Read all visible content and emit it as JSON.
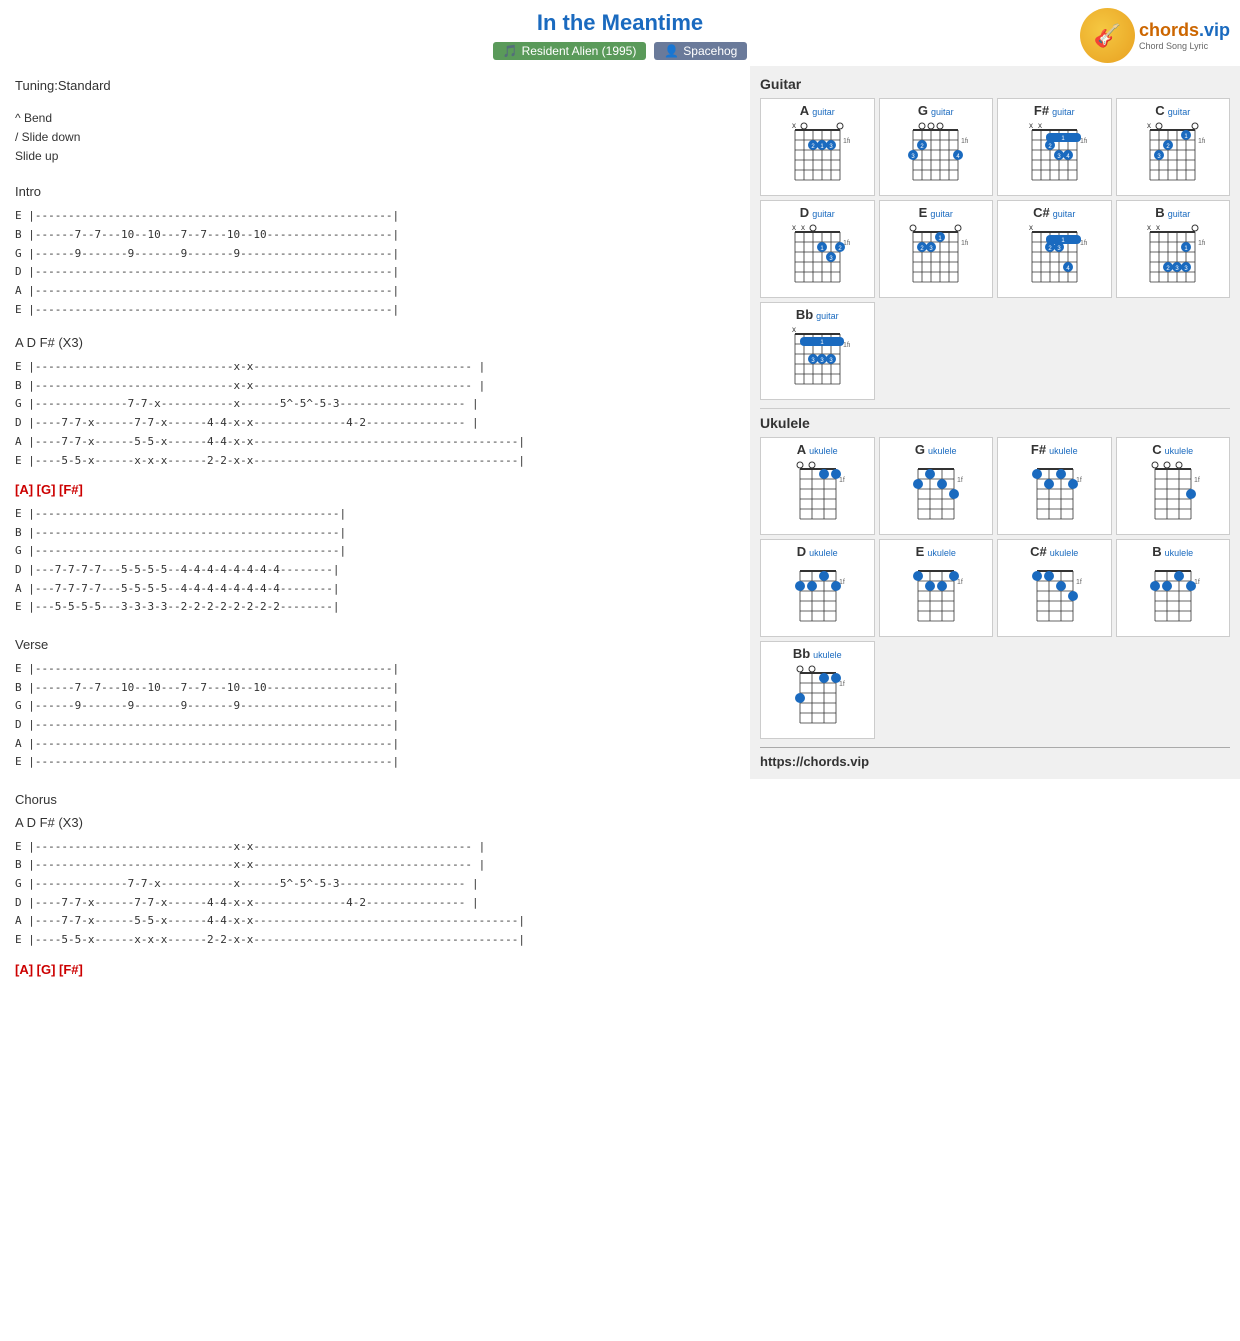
{
  "header": {
    "title": "In the Meantime",
    "album_tag": "Resident Alien (1995)",
    "artist_tag": "Spacehog",
    "logo_url": "chords.vip"
  },
  "left": {
    "tuning": "Tuning:Standard",
    "legend": [
      "^ Bend",
      "/ Slide down",
      "Slide up"
    ],
    "sections": [
      {
        "type": "label",
        "text": "Intro"
      },
      {
        "type": "tab",
        "lines": [
          "E |------------------------------------------------------|",
          "B |------7--7---10--10---7--7---10--10-------------------|",
          "G |------9-------9-------9-------9-----------------------|",
          "D |------------------------------------------------------|",
          "A |------------------------------------------------------|",
          "E |------------------------------------------------------|"
        ]
      },
      {
        "type": "label",
        "text": "A D F# (X3)"
      },
      {
        "type": "tab",
        "lines": [
          "E |------------------------------x-x--------------------------------- |",
          "B |------------------------------x-x--------------------------------- |",
          "G |--------------7-7-x-----------x------5^-5^-5-3------------------- |",
          "D |----7-7-x------7-7-x------4-4-x-x--------------4-2--------------- |",
          "A |----7-7-x------5-5-x------4-4-x-x----------------------------------------|",
          "E |----5-5-x------x-x-x------2-2-x-x----------------------------------------|"
        ]
      },
      {
        "type": "chord_line",
        "text": "[A] [G] [F#]"
      },
      {
        "type": "tab",
        "lines": [
          "E |----------------------------------------------|",
          "B |----------------------------------------------|",
          "G |----------------------------------------------|",
          "D |---7-7-7-7---5-5-5-5--4-4-4-4-4-4-4-4--------|",
          "A |---7-7-7-7---5-5-5-5--4-4-4-4-4-4-4-4--------|",
          "E |---5-5-5-5---3-3-3-3--2-2-2-2-2-2-2-2--------|"
        ]
      },
      {
        "type": "label",
        "text": "Verse"
      },
      {
        "type": "tab",
        "lines": [
          "E |------------------------------------------------------|",
          "B |------7--7---10--10---7--7---10--10-------------------|",
          "G |------9-------9-------9-------9-----------------------|",
          "D |------------------------------------------------------|",
          "A |------------------------------------------------------|",
          "E |------------------------------------------------------|"
        ]
      },
      {
        "type": "label",
        "text": "Chorus"
      },
      {
        "type": "label",
        "text": "A D F# (X3)"
      },
      {
        "type": "tab",
        "lines": [
          "E |------------------------------x-x--------------------------------- |",
          "B |------------------------------x-x--------------------------------- |",
          "G |--------------7-7-x-----------x------5^-5^-5-3------------------- |",
          "D |----7-7-x------7-7-x------4-4-x-x--------------4-2--------------- |",
          "A |----7-7-x------5-5-x------4-4-x-x----------------------------------------|",
          "E |----5-5-x------x-x-x------2-2-x-x----------------------------------------|"
        ]
      },
      {
        "type": "chord_line",
        "text": "[A] [G] [F#]"
      }
    ]
  },
  "right": {
    "guitar_label": "Guitar",
    "ukulele_label": "Ukulele",
    "url": "https://chords.vip",
    "guitar_chords": [
      "A",
      "G",
      "F#",
      "C",
      "D",
      "E",
      "C#",
      "B",
      "Bb"
    ],
    "ukulele_chords": [
      "A",
      "G",
      "F#",
      "C",
      "D",
      "E",
      "C#",
      "B",
      "Bb"
    ]
  }
}
